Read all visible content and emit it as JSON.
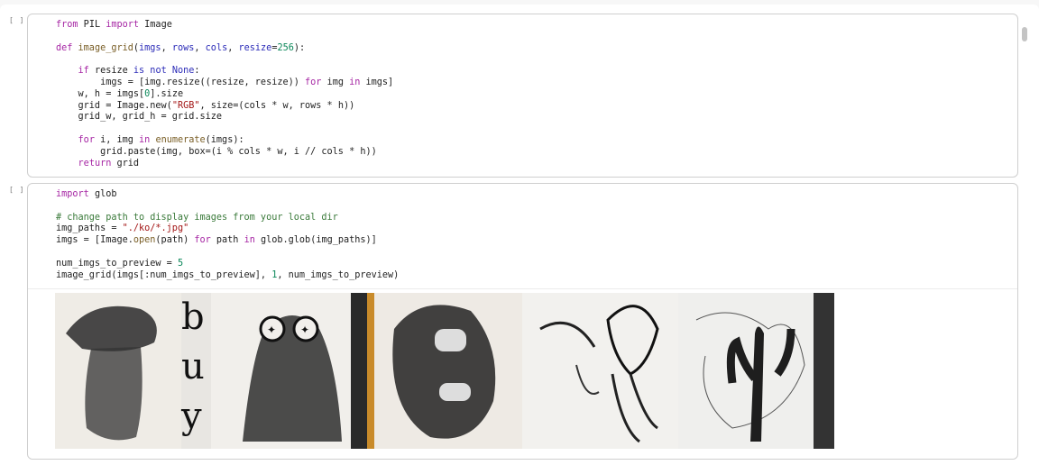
{
  "cells": [
    {
      "prompt": "[ ]",
      "lines": [
        [
          [
            "kw",
            "from"
          ],
          [
            "",
            "PIL"
          ],
          [
            "kw",
            "import"
          ],
          [
            "",
            "Image"
          ]
        ],
        [],
        [
          [
            "kw",
            "def"
          ],
          [
            "fn",
            "image_grid"
          ],
          [
            "",
            "("
          ],
          [
            "kb",
            "imgs"
          ],
          [
            "",
            ", "
          ],
          [
            "kb",
            "rows"
          ],
          [
            "",
            ", "
          ],
          [
            "kb",
            "cols"
          ],
          [
            "",
            ", "
          ],
          [
            "kb",
            "resize"
          ],
          [
            "",
            "="
          ],
          [
            "nm",
            "256"
          ],
          [
            "",
            "):"
          ]
        ],
        [],
        [
          [
            "",
            "    "
          ],
          [
            "kw",
            "if"
          ],
          [
            "",
            "resize "
          ],
          [
            "kb",
            "is not None"
          ],
          [
            "",
            ":"
          ]
        ],
        [
          [
            "",
            "        imgs = [img.resize"
          ],
          [
            "",
            "((resize, resize))"
          ],
          [
            "kw",
            " for"
          ],
          [
            "",
            "img "
          ],
          [
            "kw",
            "in"
          ],
          [
            "",
            "imgs]"
          ]
        ],
        [
          [
            "",
            "    w, h = imgs["
          ],
          [
            "nm",
            "0"
          ],
          [
            "",
            "].size"
          ]
        ],
        [
          [
            "",
            "    grid = Image.new("
          ],
          [
            "st",
            "\"RGB\""
          ],
          [
            "",
            ", size=(cols * w, rows * h))"
          ]
        ],
        [
          [
            "",
            "    grid_w, grid_h = grid.size"
          ]
        ],
        [],
        [
          [
            "",
            "    "
          ],
          [
            "kw",
            "for"
          ],
          [
            "",
            "i, img "
          ],
          [
            "kw",
            "in"
          ],
          [
            "fn",
            "enumerate"
          ],
          [
            "",
            "(imgs):"
          ]
        ],
        [
          [
            "",
            "        grid.paste(img, box=(i % cols * w, i // cols * h))"
          ]
        ],
        [
          [
            "",
            "    "
          ],
          [
            "kw",
            "return"
          ],
          [
            "",
            "grid"
          ]
        ]
      ]
    },
    {
      "prompt": "[ ]",
      "lines": [
        [
          [
            "kw",
            "import"
          ],
          [
            "",
            "glob"
          ]
        ],
        [],
        [
          [
            "cm",
            "# change path to display images from your local dir"
          ]
        ],
        [
          [
            "",
            "img_paths = "
          ],
          [
            "st",
            "\"./ko/*.jpg\""
          ]
        ],
        [
          [
            "",
            "imgs = [Image."
          ],
          [
            "fn",
            "open"
          ],
          [
            "",
            "(path) "
          ],
          [
            "kw",
            "for"
          ],
          [
            "",
            "path "
          ],
          [
            "kw",
            "in"
          ],
          [
            "",
            "glob.glob(img_paths)]"
          ]
        ],
        [],
        [
          [
            "",
            "num_imgs_to_preview = "
          ],
          [
            "nm",
            "5"
          ]
        ],
        [
          [
            "",
            "image_grid(imgs[:num_imgs_to_preview], "
          ],
          [
            "nm",
            "1"
          ],
          [
            "",
            ", num_imgs_to_preview)"
          ]
        ]
      ]
    }
  ],
  "output_images": [
    "sketch-mushroom-buy",
    "sketch-ghost-creature",
    "sketch-mask-face",
    "sketch-skeleton-monster",
    "sketch-cactus-scribble"
  ]
}
